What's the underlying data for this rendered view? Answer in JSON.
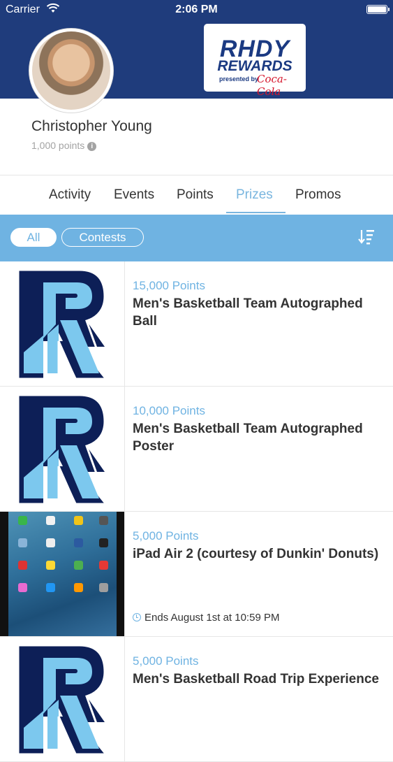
{
  "status_bar": {
    "carrier": "Carrier",
    "time": "2:06 PM"
  },
  "header": {
    "logo_line1": "RHDY",
    "logo_line2": "REWARDS",
    "logo_presented": "presented by",
    "logo_sponsor": "Coca-Cola"
  },
  "profile": {
    "name": "Christopher Young",
    "points": "1,000 points"
  },
  "tabs": [
    {
      "label": "Activity"
    },
    {
      "label": "Events"
    },
    {
      "label": "Points"
    },
    {
      "label": "Prizes",
      "active": true
    },
    {
      "label": "Promos"
    }
  ],
  "filters": {
    "all": "All",
    "contests": "Contests"
  },
  "prizes": [
    {
      "points": "15,000 Points",
      "title": "Men's Basketball Team Autographed Ball",
      "image": "rhody-r-logo"
    },
    {
      "points": "10,000 Points",
      "title": "Men's Basketball Team Autographed Poster",
      "image": "rhody-r-logo"
    },
    {
      "points": "5,000 Points",
      "title": "iPad Air 2 (courtesy of Dunkin' Donuts)",
      "image": "ipad-photo",
      "ends": "Ends August 1st at 10:59 PM"
    },
    {
      "points": "5,000 Points",
      "title": "Men's Basketball Road Trip Experience",
      "image": "rhody-r-logo"
    }
  ],
  "colors": {
    "header_bg": "#1f3c7c",
    "accent": "#6fb3e2",
    "text": "#333333",
    "muted": "#a3a3a3",
    "r_navy": "#0d1f57",
    "r_light": "#7cc8ee"
  }
}
